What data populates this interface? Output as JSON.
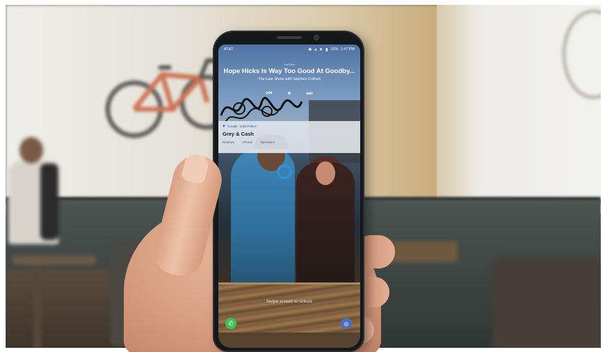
{
  "phone": {
    "status_bar": {
      "carrier": "AT&T",
      "icons": "✱ ◂ ▼ ▮",
      "battery": "33%",
      "time": "1:47 PM"
    },
    "media": {
      "app": "YouTube",
      "title": "Hope Hicks Is Way Too Good At Goodby...",
      "subtitle": "The Late Show with Stephen Colbert",
      "controls": {
        "previous_icon": "previous-track-icon",
        "pause_icon": "pause-icon",
        "next_icon": "next-track-icon"
      }
    },
    "notification": {
      "app": "Google",
      "app_meta": "Gold Palace",
      "title": "Grey & Cash",
      "actions": [
        "Reviews",
        "Photos",
        "Directions"
      ]
    },
    "lock_screen": {
      "unlock_hint": "Swipe screen to unlock",
      "left_shortcut_icon": "phone-icon",
      "right_shortcut_icon": "camera-icon"
    }
  },
  "colors": {
    "shortcut_phone": "#3fbf5a",
    "shortcut_camera": "#4a6fc4",
    "notification_accent": "#2a62a8"
  }
}
